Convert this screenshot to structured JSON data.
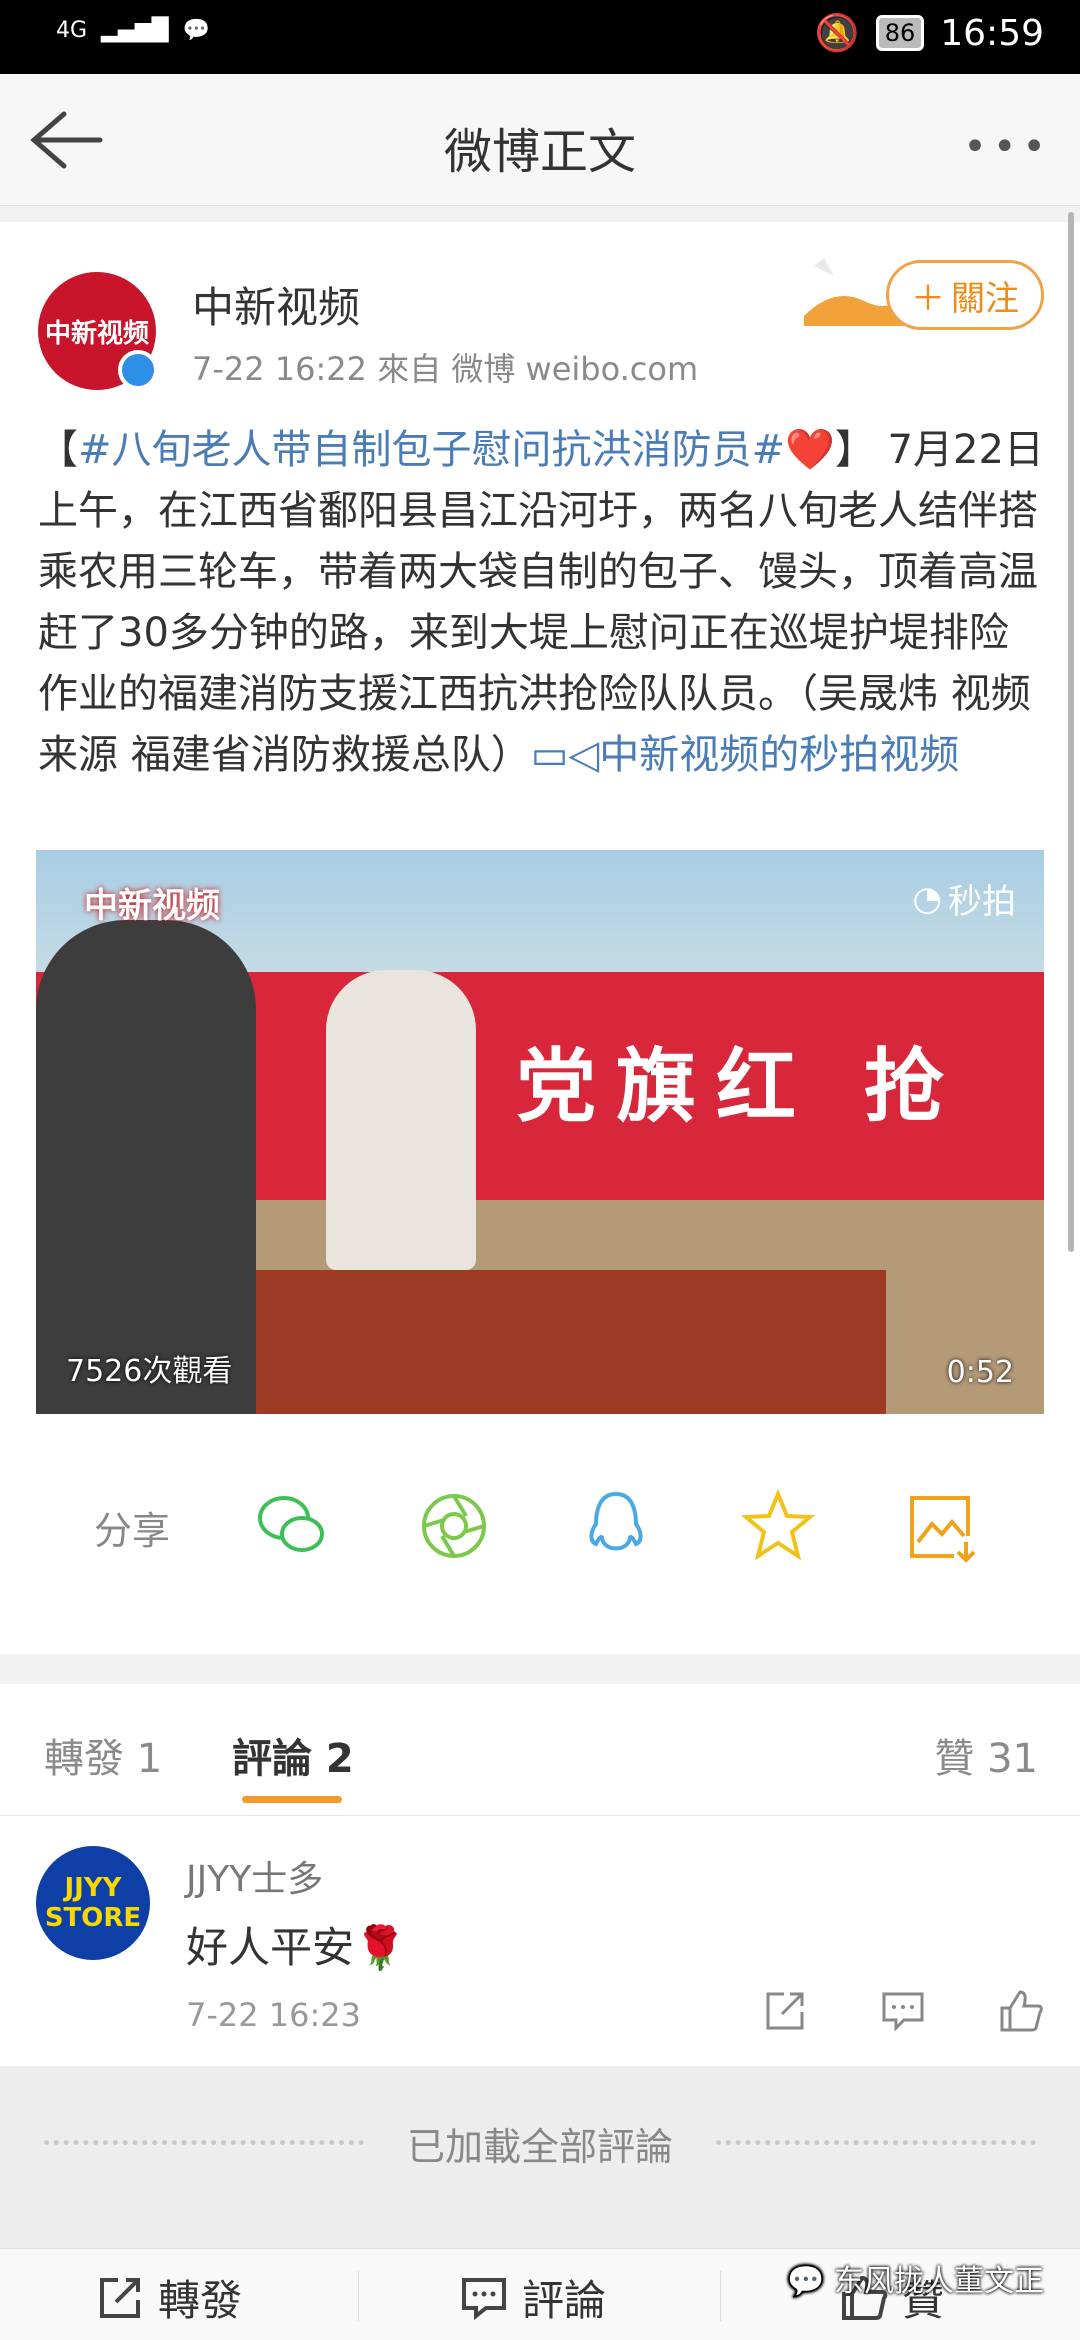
{
  "status_bar": {
    "network": "4G",
    "battery": "86",
    "time": "16:59"
  },
  "nav": {
    "title": "微博正文"
  },
  "post": {
    "username": "中新视频",
    "avatar_text": "中新视频",
    "meta": "7-22 16:22  來自 微博 weibo.com",
    "follow_label": "關注",
    "text_open": "【",
    "hashtag": "#八旬老人带自制包子慰问抗洪消防员#",
    "text_main": "】 7月22日上午，在江西省鄱阳县昌江沿河圩，两名八旬老人结伴搭乘农用三轮车，带着两大袋自制的包子、馒头，顶着高温赶了30多分钟的路，来到大堤上慰问正在巡堤护堤排险作业的福建消防支援江西抗洪抢险队队员。（吴晟炜 视频来源 福建省消防救援总队）",
    "video_link": "中新视频的秒拍视频",
    "video": {
      "logo": "中新视频",
      "brand": "秒拍",
      "views": "7526次觀看",
      "duration": "0:52",
      "banner_text": "党旗红  抢"
    }
  },
  "share": {
    "label": "分享"
  },
  "tabs": {
    "repost": "轉發 1",
    "comment": "評論 2",
    "like": "贊 31"
  },
  "comments": [
    {
      "name": "JJYY士多",
      "avatar_text": "JJYY STORE",
      "text": "好人平安🌹",
      "time": "7-22 16:23"
    }
  ],
  "loaded_text": "已加載全部評論",
  "bottom_bar": {
    "repost": "轉發",
    "comment": "評論",
    "like": "贊"
  },
  "watermark": "东风拢人董文正",
  "colors": {
    "accent": "#f08a18",
    "link": "#4a7db5",
    "brand_red": "#c8152b"
  }
}
